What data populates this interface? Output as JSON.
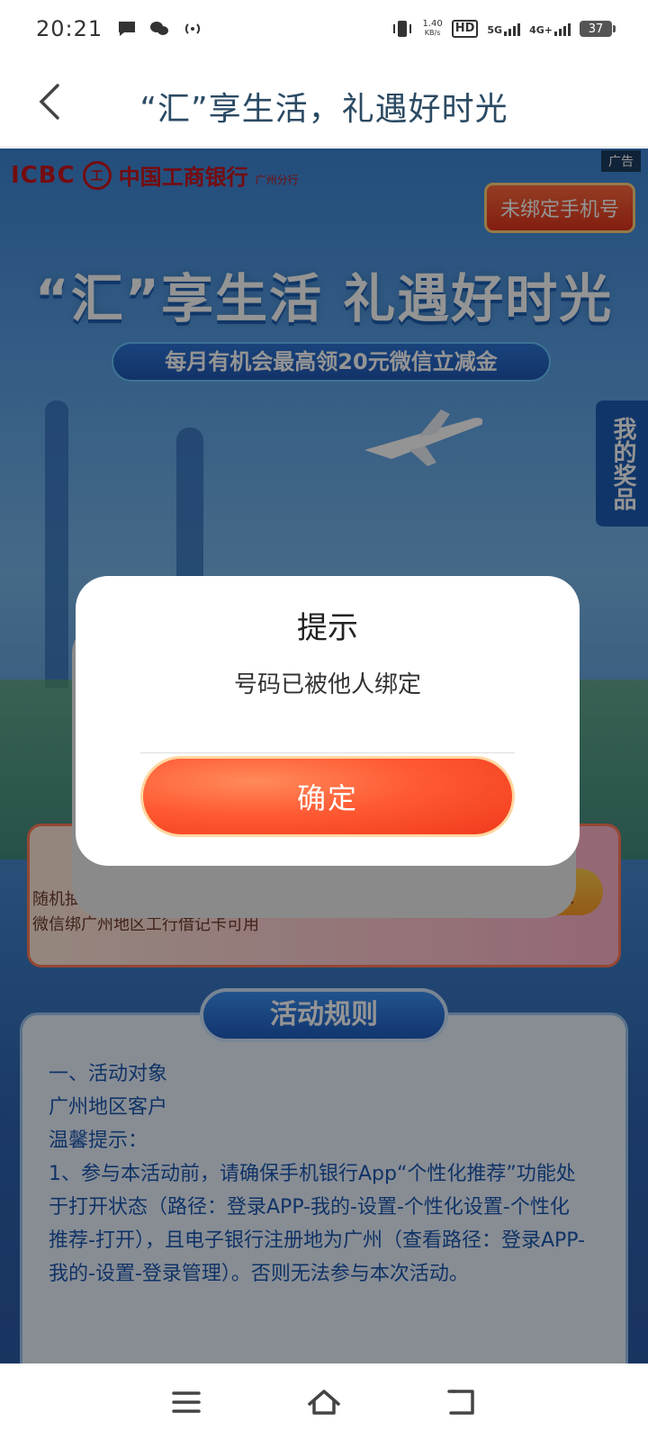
{
  "status_bar": {
    "time": "20:21",
    "net_speed_value": "1.40",
    "net_speed_unit": "KB/s",
    "hd_label": "HD",
    "sim1_network": "5G",
    "sim2_network": "4G+",
    "battery": "37"
  },
  "header": {
    "title": "“汇”享生活，礼遇好时光"
  },
  "banner": {
    "ad_tag": "广告",
    "bank_short": "ICBC",
    "bank_name": "中国工商银行",
    "branch": "广州分行",
    "bind_phone_button": "未绑定手机号",
    "hero_title": "“汇”享生活  礼遇好时光",
    "hero_subtitle": "每月有机会最高领20元微信立减金",
    "my_prizes": "我的奖品"
  },
  "coupon": {
    "line1": "随机抽，券7天有效",
    "line2": "微信绑广州地区工行借记卡可用",
    "claim_button": "取"
  },
  "rules": {
    "heading": "活动规则",
    "lines": [
      "一、活动对象",
      "广州地区客户",
      "温馨提示：",
      "1、参与本活动前，请确保手机银行App“个性化推荐”功能处于打开状态（路径：登录APP-我的-设置-个性化设置-个性化推荐-打开），且电子银行注册地为广州（查看路径：登录APP-我的-设置-登录管理）。否则无法参与本次活动。"
    ]
  },
  "dialog": {
    "title": "提示",
    "message": "号码已被他人绑定",
    "confirm": "确定"
  },
  "nav": {
    "icons": [
      "menu-icon",
      "home-icon",
      "back-icon"
    ]
  }
}
